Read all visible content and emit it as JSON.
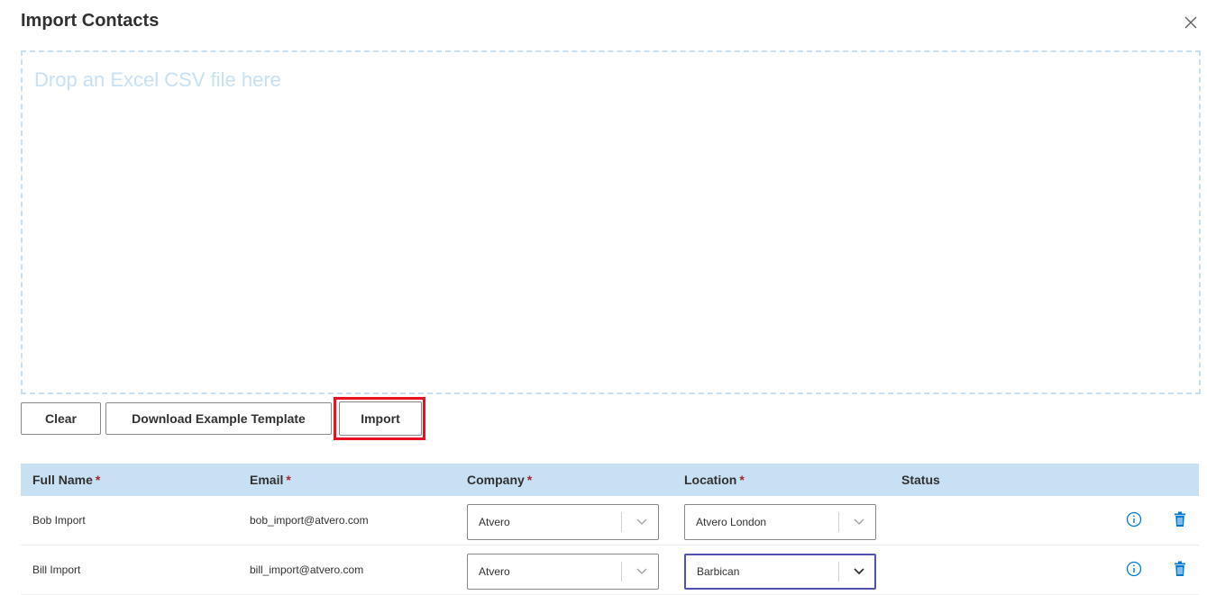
{
  "dialog": {
    "title": "Import Contacts",
    "close_icon": "close-icon"
  },
  "dropzone": {
    "placeholder": "Drop an Excel CSV file here"
  },
  "actions": {
    "clear_label": "Clear",
    "download_template_label": "Download Example Template",
    "import_label": "Import"
  },
  "table": {
    "columns": {
      "full_name": "Full Name",
      "email": "Email",
      "company": "Company",
      "location": "Location",
      "status": "Status",
      "required_marker": "*"
    },
    "rows": [
      {
        "full_name": "Bob Import",
        "email": "bob_import@atvero.com",
        "company": "Atvero",
        "location": "Atvero London",
        "status": ""
      },
      {
        "full_name": "Bill Import",
        "email": "bill_import@atvero.com",
        "company": "Atvero",
        "location": "Barbican",
        "status": ""
      }
    ]
  },
  "colors": {
    "header_bg": "#c7e0f4",
    "dropzone_border": "#c7e0f4",
    "required": "#a4262c",
    "highlight": "#e81123",
    "icon_blue": "#0078d4",
    "focus_border": "#4f52b2"
  },
  "icons": {
    "info": "info-icon",
    "delete": "trash-icon",
    "chevron": "chevron-down-icon"
  }
}
